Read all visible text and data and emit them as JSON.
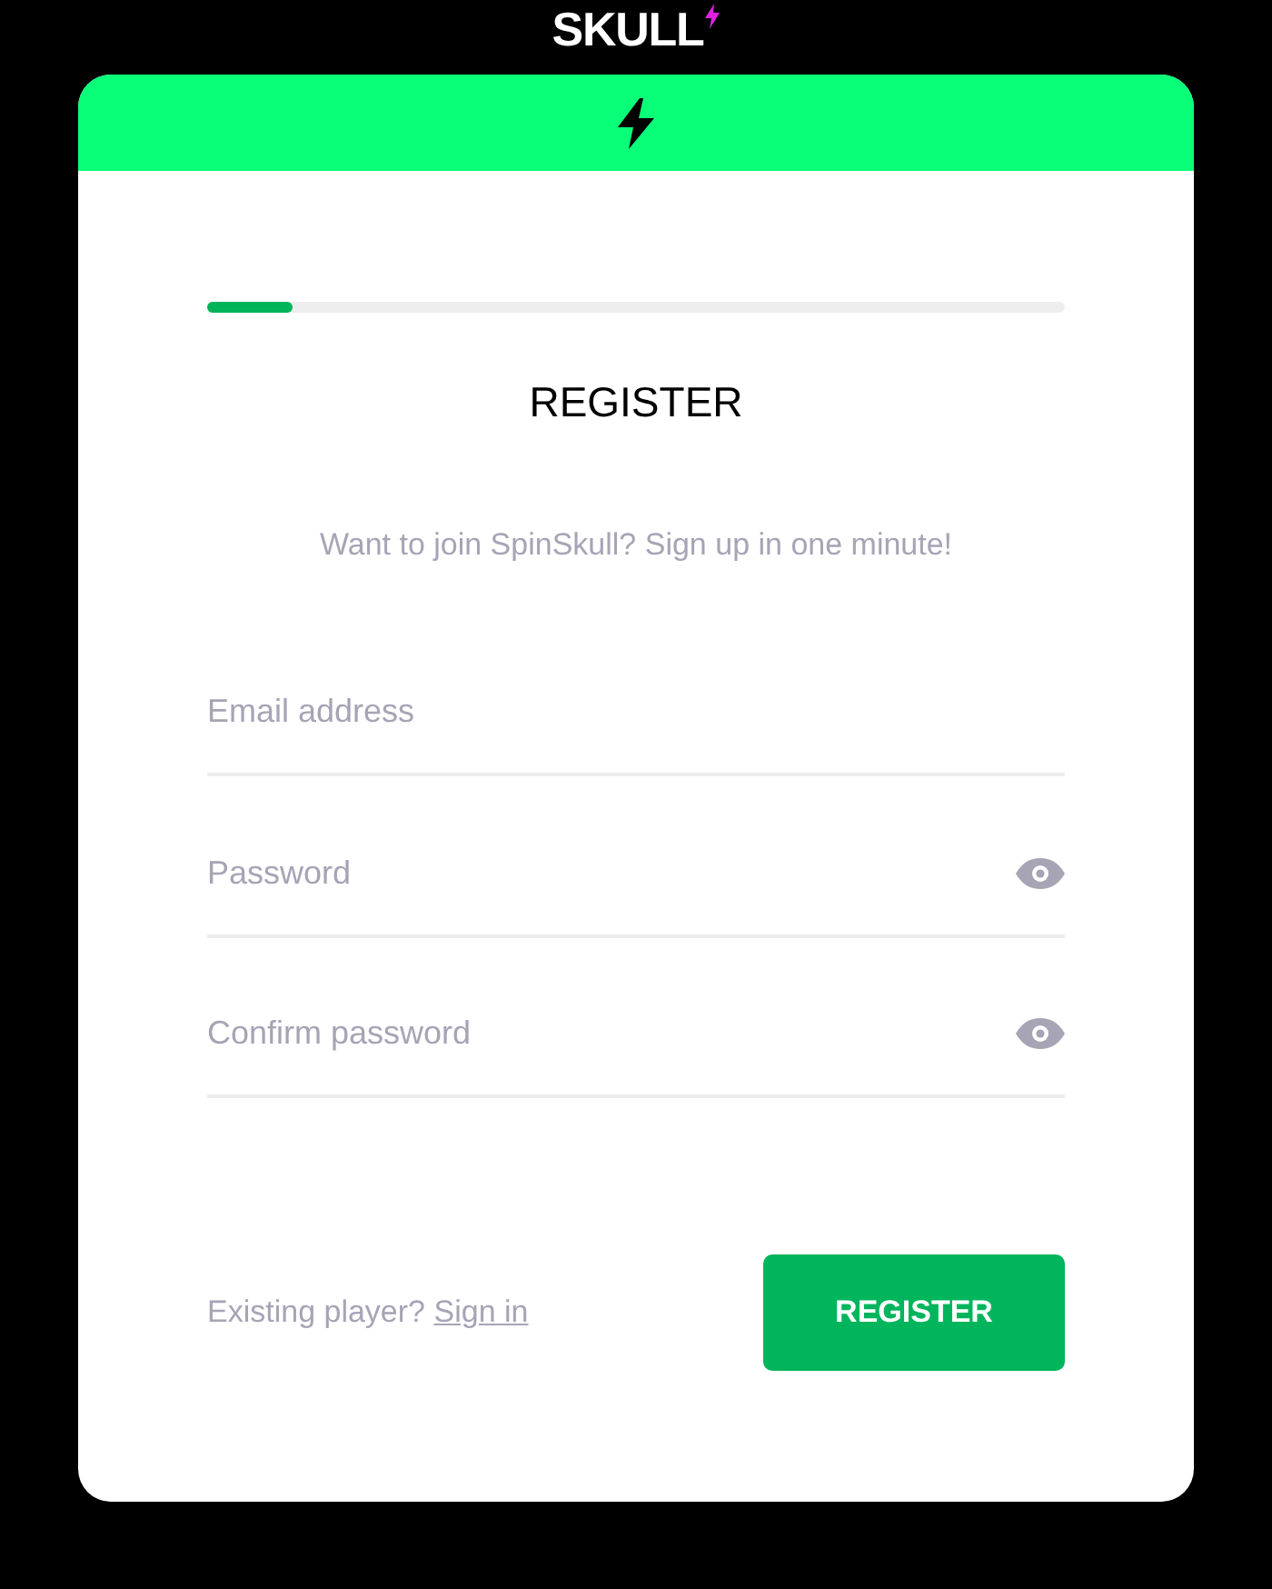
{
  "logo": {
    "text": "SKULL"
  },
  "progress": {
    "level": 0.1
  },
  "title": "REGISTER",
  "subtitle": "Want to join SpinSkull? Sign up in one minute!",
  "fields": [
    {
      "kind": "text",
      "placeholder": "Email address"
    },
    {
      "kind": "password",
      "placeholder": "Password"
    },
    {
      "kind": "password",
      "placeholder": "Confirm password"
    }
  ],
  "footer": {
    "prompt": "Existing player?",
    "link": "Sign in"
  },
  "button": "REGISTER"
}
